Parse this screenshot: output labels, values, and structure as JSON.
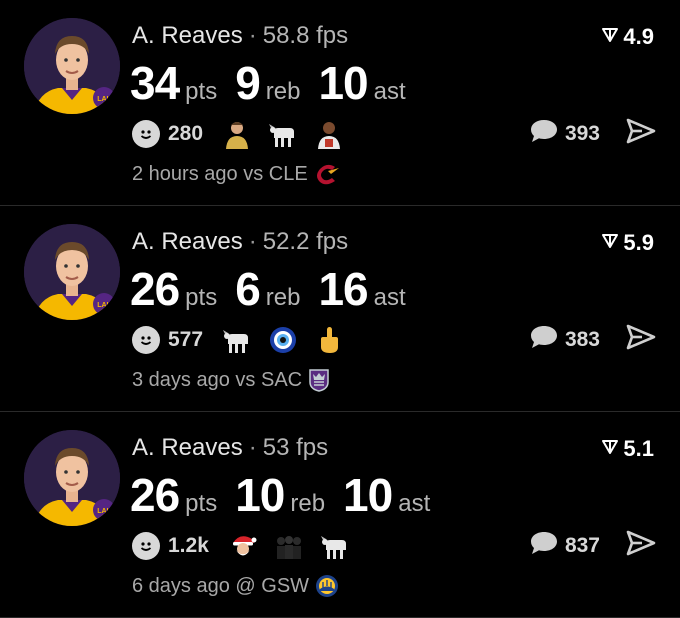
{
  "posts": [
    {
      "player": "A. Reaves",
      "separator": "·",
      "fps": "58.8 fps",
      "rating": "4.9",
      "stats": [
        {
          "value": "34",
          "unit": "pts"
        },
        {
          "value": "9",
          "unit": "reb"
        },
        {
          "value": "10",
          "unit": "ast"
        }
      ],
      "reaction_count": "280",
      "reaction_emojis": [
        "player-icon",
        "goat-icon",
        "player-icon"
      ],
      "comment_count": "393",
      "time": "2 hours ago",
      "opponent": "vs CLE",
      "opponent_logo": "cavaliers-logo"
    },
    {
      "player": "A. Reaves",
      "separator": "·",
      "fps": "52.2 fps",
      "rating": "5.9",
      "stats": [
        {
          "value": "26",
          "unit": "pts"
        },
        {
          "value": "6",
          "unit": "reb"
        },
        {
          "value": "16",
          "unit": "ast"
        }
      ],
      "reaction_count": "577",
      "reaction_emojis": [
        "goat-icon",
        "nazar-amulet-icon",
        "middle-finger-icon"
      ],
      "comment_count": "383",
      "time": "3 days ago",
      "opponent": "vs SAC",
      "opponent_logo": "kings-logo"
    },
    {
      "player": "A. Reaves",
      "separator": "·",
      "fps": "53 fps",
      "rating": "5.1",
      "stats": [
        {
          "value": "26",
          "unit": "pts"
        },
        {
          "value": "10",
          "unit": "reb"
        },
        {
          "value": "10",
          "unit": "ast"
        }
      ],
      "reaction_count": "1.2k",
      "reaction_emojis": [
        "santa-icon",
        "people-icon",
        "goat-icon"
      ],
      "comment_count": "837",
      "time": "6 days ago",
      "opponent": "@ GSW",
      "opponent_logo": "warriors-logo"
    }
  ],
  "colors": {
    "background": "#000000",
    "text": "#ffffff",
    "muted": "#a8a8a8",
    "lakers_gold": "#f5b800",
    "lakers_purple": "#552583"
  }
}
